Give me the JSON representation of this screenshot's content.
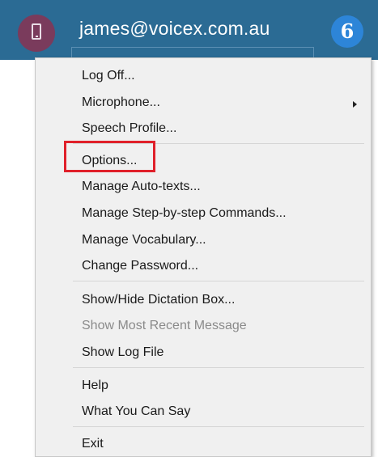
{
  "header": {
    "account_email": "james@voicex.com.au",
    "device_icon": "phone-icon",
    "logo_icon": "dragon-logo-icon",
    "colors": {
      "bar": "#2b6b94",
      "device_circle": "#7a3b5c",
      "logo": "#2d85d8"
    }
  },
  "menu": {
    "items": [
      {
        "label": "Log Off..."
      },
      {
        "label": "Microphone...",
        "has_submenu": true
      },
      {
        "label": "Speech Profile..."
      },
      {
        "label": "Options...",
        "highlighted": true
      },
      {
        "label": "Manage Auto-texts..."
      },
      {
        "label": "Manage Step-by-step Commands..."
      },
      {
        "label": "Manage Vocabulary..."
      },
      {
        "label": "Change Password..."
      },
      {
        "label": "Show/Hide Dictation Box..."
      },
      {
        "label": "Show Most Recent Message",
        "disabled": true
      },
      {
        "label": "Show Log File"
      },
      {
        "label": "Help"
      },
      {
        "label": "What You Can Say"
      },
      {
        "label": "Exit"
      }
    ],
    "highlight_color": "#e0202a"
  }
}
